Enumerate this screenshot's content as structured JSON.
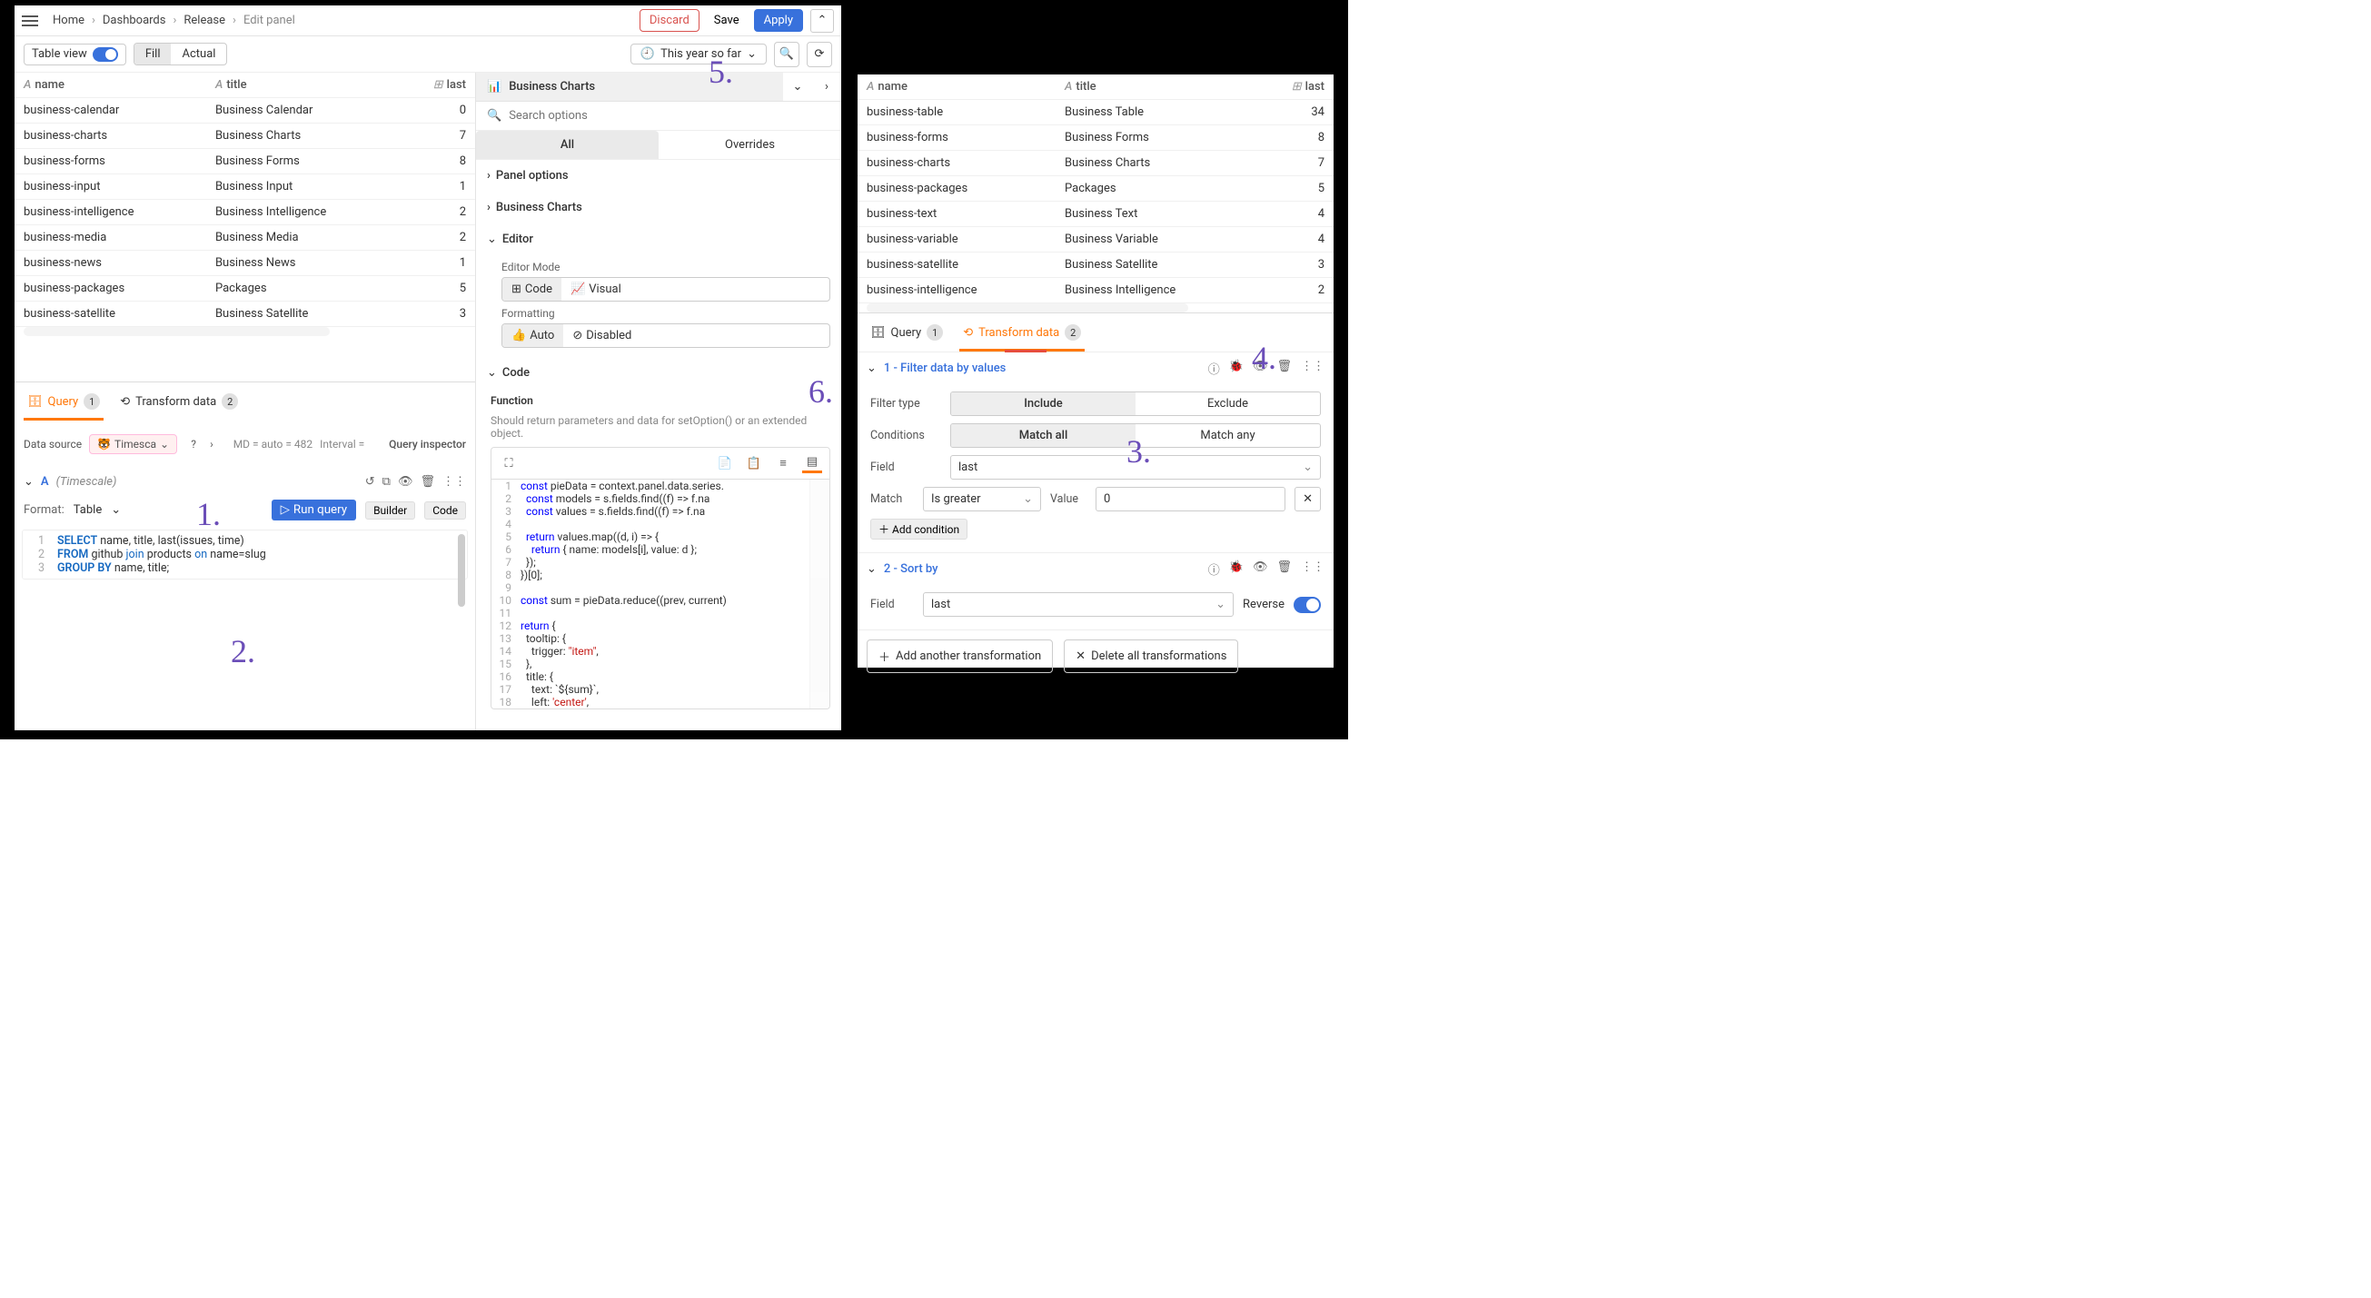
{
  "breadcrumb": {
    "home": "Home",
    "dashboards": "Dashboards",
    "release": "Release",
    "edit_panel": "Edit panel"
  },
  "actions": {
    "discard": "Discard",
    "save": "Save",
    "apply": "Apply"
  },
  "toolbar": {
    "table_view": "Table view",
    "fill": "Fill",
    "actual": "Actual",
    "time_range": "This year so far"
  },
  "left_table": {
    "headers": {
      "name": "name",
      "title": "title",
      "last": "last"
    },
    "rows": [
      {
        "name": "business-calendar",
        "title": "Business Calendar",
        "last": "0"
      },
      {
        "name": "business-charts",
        "title": "Business Charts",
        "last": "7"
      },
      {
        "name": "business-forms",
        "title": "Business Forms",
        "last": "8"
      },
      {
        "name": "business-input",
        "title": "Business Input",
        "last": "1"
      },
      {
        "name": "business-intelligence",
        "title": "Business Intelligence",
        "last": "2"
      },
      {
        "name": "business-media",
        "title": "Business Media",
        "last": "2"
      },
      {
        "name": "business-news",
        "title": "Business News",
        "last": "1"
      },
      {
        "name": "business-packages",
        "title": "Packages",
        "last": "5"
      },
      {
        "name": "business-satellite",
        "title": "Business Satellite",
        "last": "3"
      }
    ]
  },
  "left_tabs": {
    "query": "Query",
    "query_count": "1",
    "transform": "Transform data",
    "transform_count": "2"
  },
  "data_source": {
    "label": "Data source",
    "name": "Timesca",
    "md": "MD = auto = 482",
    "interval": "Interval = ",
    "inspector": "Query inspector"
  },
  "query_a": {
    "letter": "A",
    "ds": "(Timescale)",
    "format_label": "Format:",
    "format_value": "Table",
    "run": "Run query",
    "builder": "Builder",
    "code": "Code",
    "lines": [
      {
        "n": "1",
        "t": "SELECT name, title, last(issues, time)"
      },
      {
        "n": "2",
        "t": "FROM github join products on name=slug"
      },
      {
        "n": "3",
        "t": "GROUP BY name, title;"
      }
    ]
  },
  "viz": {
    "name": "Business Charts"
  },
  "search": {
    "placeholder": "Search options"
  },
  "opt_tabs": {
    "all": "All",
    "overrides": "Overrides"
  },
  "sections": {
    "panel_options": "Panel options",
    "business_charts": "Business Charts",
    "editor": "Editor",
    "editor_mode_label": "Editor Mode",
    "code": "Code",
    "visual": "Visual",
    "formatting_label": "Formatting",
    "auto": "Auto",
    "disabled": "Disabled",
    "code_section": "Code",
    "function_label": "Function",
    "function_help": "Should return parameters and data for setOption() or an extended object."
  },
  "code_lines": [
    {
      "n": "1",
      "t": "const pieData = context.panel.data.series."
    },
    {
      "n": "2",
      "t": "  const models = s.fields.find((f) => f.na"
    },
    {
      "n": "3",
      "t": "  const values = s.fields.find((f) => f.na"
    },
    {
      "n": "4",
      "t": ""
    },
    {
      "n": "5",
      "t": "  return values.map((d, i) => {"
    },
    {
      "n": "6",
      "t": "    return { name: models[i], value: d };"
    },
    {
      "n": "7",
      "t": "  });"
    },
    {
      "n": "8",
      "t": "})[0];"
    },
    {
      "n": "9",
      "t": ""
    },
    {
      "n": "10",
      "t": "const sum = pieData.reduce((prev, current)"
    },
    {
      "n": "11",
      "t": ""
    },
    {
      "n": "12",
      "t": "return {"
    },
    {
      "n": "13",
      "t": "  tooltip: {"
    },
    {
      "n": "14",
      "t": "    trigger: \"item\","
    },
    {
      "n": "15",
      "t": "  },"
    },
    {
      "n": "16",
      "t": "  title: {"
    },
    {
      "n": "17",
      "t": "    text: `${sum}`,"
    },
    {
      "n": "18",
      "t": "    left: 'center',"
    }
  ],
  "right_table": {
    "headers": {
      "name": "name",
      "title": "title",
      "last": "last"
    },
    "rows": [
      {
        "name": "business-table",
        "title": "Business Table",
        "last": "34"
      },
      {
        "name": "business-forms",
        "title": "Business Forms",
        "last": "8"
      },
      {
        "name": "business-charts",
        "title": "Business Charts",
        "last": "7"
      },
      {
        "name": "business-packages",
        "title": "Packages",
        "last": "5"
      },
      {
        "name": "business-text",
        "title": "Business Text",
        "last": "4"
      },
      {
        "name": "business-variable",
        "title": "Business Variable",
        "last": "4"
      },
      {
        "name": "business-satellite",
        "title": "Business Satellite",
        "last": "3"
      },
      {
        "name": "business-intelligence",
        "title": "Business Intelligence",
        "last": "2"
      }
    ]
  },
  "right_tabs": {
    "query": "Query",
    "query_count": "1",
    "transform": "Transform data",
    "transform_count": "2"
  },
  "xform1": {
    "title": "1 - Filter data by values",
    "filter_type": "Filter type",
    "include": "Include",
    "exclude": "Exclude",
    "conditions": "Conditions",
    "match_all": "Match all",
    "match_any": "Match any",
    "field_label": "Field",
    "field_value": "last",
    "match_label": "Match",
    "match_value": "Is greater",
    "value_label": "Value",
    "value_value": "0",
    "add_condition": "Add condition"
  },
  "xform2": {
    "title": "2 - Sort by",
    "field_label": "Field",
    "field_value": "last",
    "reverse": "Reverse"
  },
  "xform_actions": {
    "add": "Add another transformation",
    "del": "Delete all transformations"
  },
  "callouts": {
    "c1": "1.",
    "c2": "2.",
    "c3": "3.",
    "c4": "4.",
    "c5": "5.",
    "c6": "6."
  }
}
